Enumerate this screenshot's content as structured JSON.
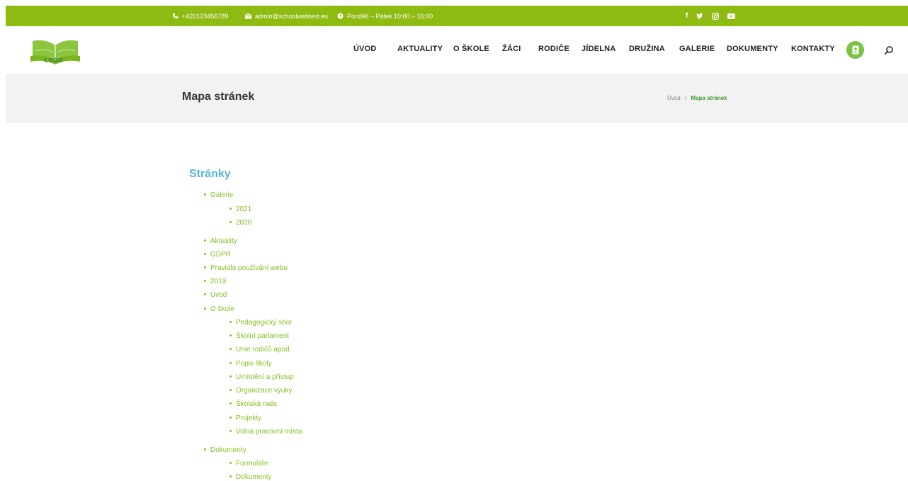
{
  "topbar": {
    "phone": "+420123456789",
    "email": "admin@schoolwebtest.eu",
    "hours": "Pondělí – Pátek 10:00 – 16:00",
    "social": [
      "facebook-icon",
      "twitter-icon",
      "instagram-icon",
      "youtube-icon"
    ],
    "bg_color": "#8dbb12"
  },
  "logo": {
    "text": "LOGO"
  },
  "nav": {
    "items": [
      "ÚVOD",
      "AKTUALITY",
      "O ŠKOLE",
      "ŽÁCI",
      "RODIČE",
      "JÍDELNA",
      "DRUŽINA",
      "GALERIE",
      "DOKUMENTY",
      "KONTAKTY"
    ]
  },
  "titlebar": {
    "title": "Mapa stránek",
    "breadcrumb_home": "Úvod",
    "breadcrumb_sep": "/",
    "breadcrumb_current": "Mapa stránek"
  },
  "sitemap": {
    "heading": "Stránky",
    "items": [
      {
        "label": "Galerie",
        "level": 0
      },
      {
        "label": "2021",
        "level": 1
      },
      {
        "label": "2020",
        "level": 1
      },
      {
        "label": "Aktuality",
        "level": 0
      },
      {
        "label": "GDPR",
        "level": 0
      },
      {
        "label": "Pravidla používání webu",
        "level": 0
      },
      {
        "label": "2019",
        "level": 0
      },
      {
        "label": "Úvod",
        "level": 0
      },
      {
        "label": "O škole",
        "level": 0
      },
      {
        "label": "Pedagogický sbor",
        "level": 1
      },
      {
        "label": "Školní parlament",
        "level": 1
      },
      {
        "label": "Unie rodičů apod.",
        "level": 1
      },
      {
        "label": "Popis školy",
        "level": 1
      },
      {
        "label": "Umístění a přístup",
        "level": 1
      },
      {
        "label": "Organizace výuky",
        "level": 1
      },
      {
        "label": "Školská rada",
        "level": 1
      },
      {
        "label": "Projekty",
        "level": 1
      },
      {
        "label": "Volná pracovní místa",
        "level": 1
      },
      {
        "label": "Dokumenty",
        "level": 0
      },
      {
        "label": "Formuláře",
        "level": 1
      },
      {
        "label": "Dokumenty",
        "level": 1
      }
    ]
  },
  "colors": {
    "accent_green": "#84c125",
    "heading_blue": "#58b4da",
    "badge_green": "#7bc142"
  }
}
